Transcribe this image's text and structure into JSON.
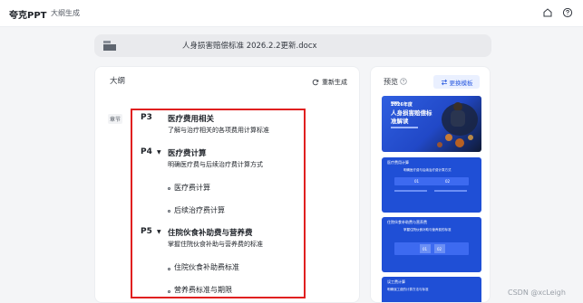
{
  "app": {
    "brand": "夸克PPT",
    "breadcrumb": "大纲生成"
  },
  "file": {
    "name": "人身损害赔偿标准 2026.2.2更新.docx"
  },
  "outline": {
    "title": "大纲",
    "regenerate_label": "重新生成",
    "chapter_tag": "章节",
    "sections": [
      {
        "page": "P3",
        "title": "医疗费用相关",
        "desc": "了解与治疗相关的各项费用计算标准",
        "items": []
      },
      {
        "page": "P4",
        "title": "医疗费计算",
        "desc": "明确医疗费与后续治疗费计算方式",
        "items": [
          "医疗费计算",
          "后续治疗费计算"
        ]
      },
      {
        "page": "P5",
        "title": "住院伙食补助费与营养费",
        "desc": "掌握住院伙食补助与营养费的标准",
        "items": [
          "住院伙食补助费标准",
          "营养费标准与期限"
        ]
      }
    ]
  },
  "preview": {
    "title": "预览",
    "swap_label": "更换模板",
    "slides": [
      {
        "line1": "2026年度",
        "line2": "人身损害赔偿标",
        "line3": "准解读"
      },
      {
        "header": "医疗费用计算",
        "sub": "明确医疗费与后续治疗费计算方式",
        "n1": "01",
        "n2": "02"
      },
      {
        "header": "住院伙食补助费与营养费",
        "sub": "掌握住院伙食补助与营养费的标准",
        "n1": "01",
        "n2": "02"
      },
      {
        "header": "误工费计算",
        "sub": "明确误工费的计算方法与标准"
      }
    ]
  },
  "watermark": "CSDN @xcLeigh",
  "colors": {
    "accent": "#2b5be0",
    "highlight_border": "#e02020",
    "slide_blue": "#1f4fd6"
  }
}
